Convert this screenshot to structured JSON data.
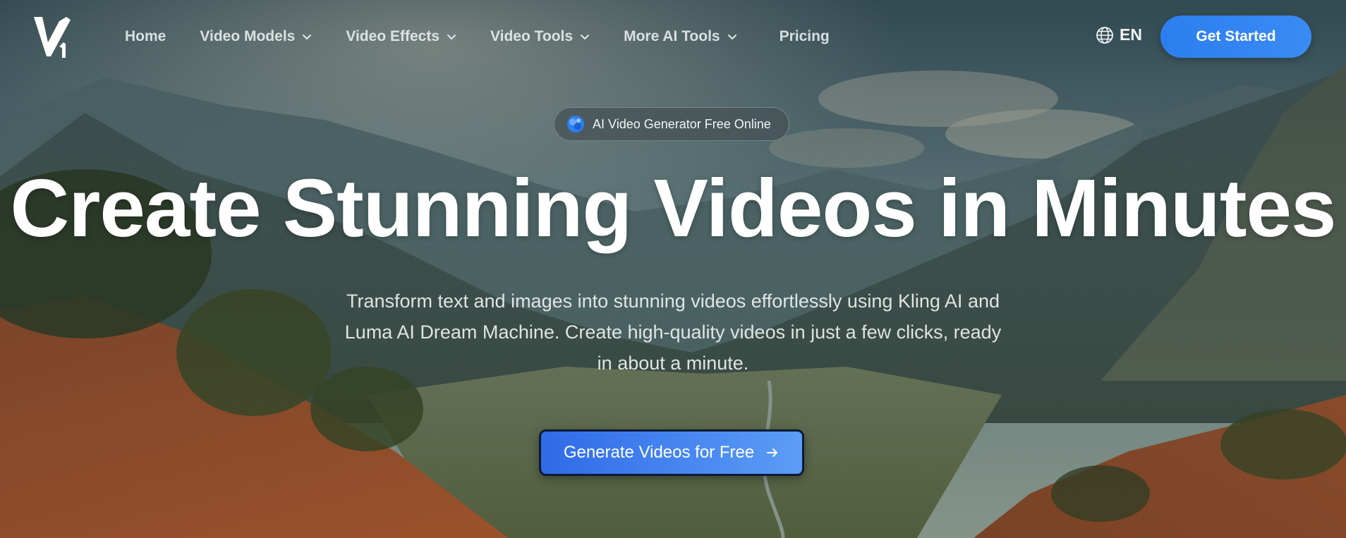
{
  "nav": {
    "items": [
      {
        "label": "Home",
        "has_dropdown": false
      },
      {
        "label": "Video Models",
        "has_dropdown": true
      },
      {
        "label": "Video Effects",
        "has_dropdown": true
      },
      {
        "label": "Video Tools",
        "has_dropdown": true
      },
      {
        "label": "More AI Tools",
        "has_dropdown": true
      },
      {
        "label": "Pricing",
        "has_dropdown": false
      }
    ],
    "language": "EN",
    "cta_label": "Get Started"
  },
  "logo": {
    "icon": "v1-logo"
  },
  "hero": {
    "badge": "AI Video Generator Free Online",
    "headline": "Create Stunning Videos in Minutes",
    "subtitle_lines": [
      "Transform text and images into stunning videos effortlessly using Kling AI and",
      "Luma AI Dream Machine. Create high-quality videos in just a few clicks, ready",
      "in about a minute."
    ],
    "cta_label": "Generate Videos for Free"
  },
  "icons": {
    "language": "globe-icon",
    "dropdown": "chevron-down-icon",
    "cta": "arrow-right-icon",
    "badge": "ai-spark-icon"
  },
  "colors": {
    "accent": "#2c7ef0",
    "cta_start": "#2f6be8",
    "cta_end": "#5b9df6"
  }
}
